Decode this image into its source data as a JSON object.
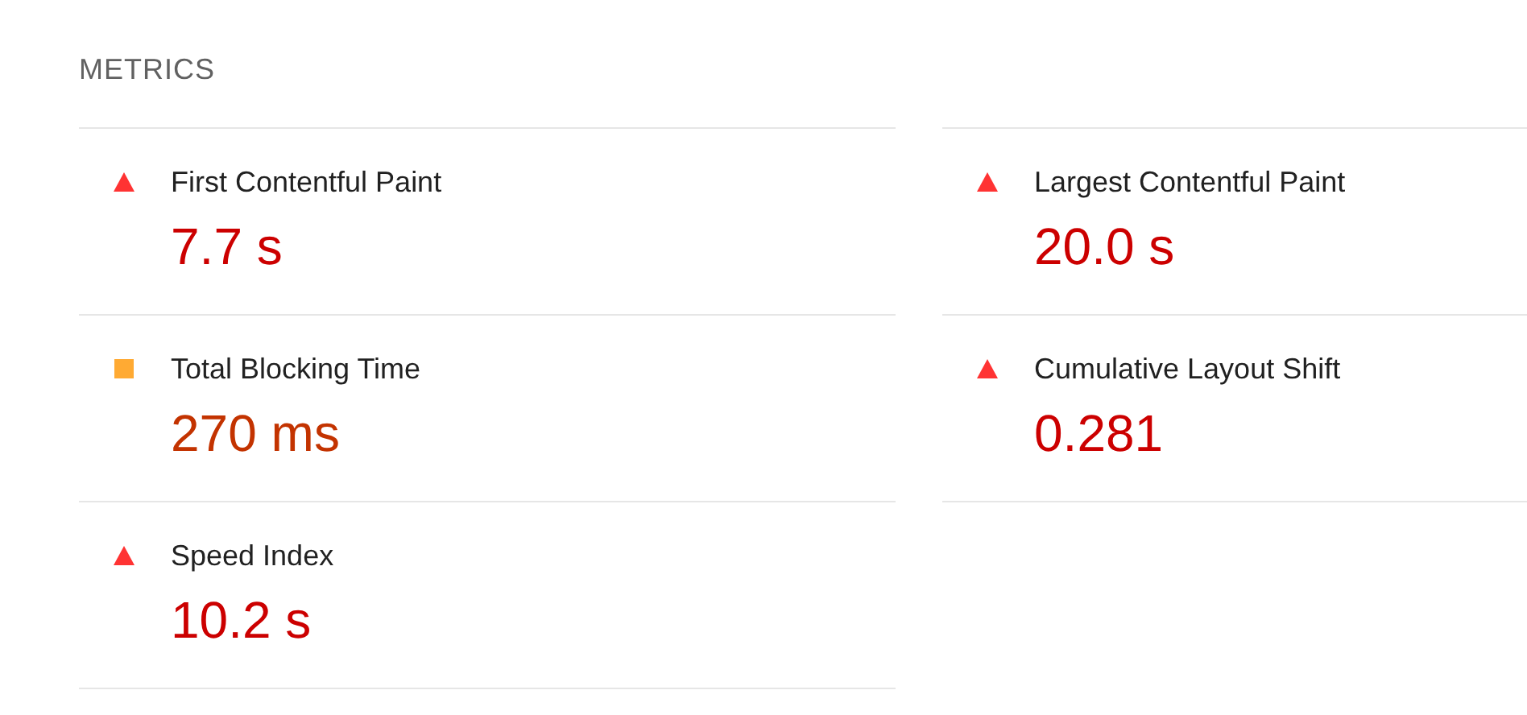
{
  "section_title": "METRICS",
  "columns": [
    [
      {
        "kind": "fail",
        "label": "First Contentful Paint",
        "value": "7.7 s"
      },
      {
        "kind": "average",
        "label": "Total Blocking Time",
        "value": "270 ms"
      },
      {
        "kind": "fail",
        "label": "Speed Index",
        "value": "10.2 s"
      }
    ],
    [
      {
        "kind": "fail",
        "label": "Largest Contentful Paint",
        "value": "20.0 s"
      },
      {
        "kind": "fail",
        "label": "Cumulative Layout Shift",
        "value": "0.281"
      }
    ]
  ]
}
